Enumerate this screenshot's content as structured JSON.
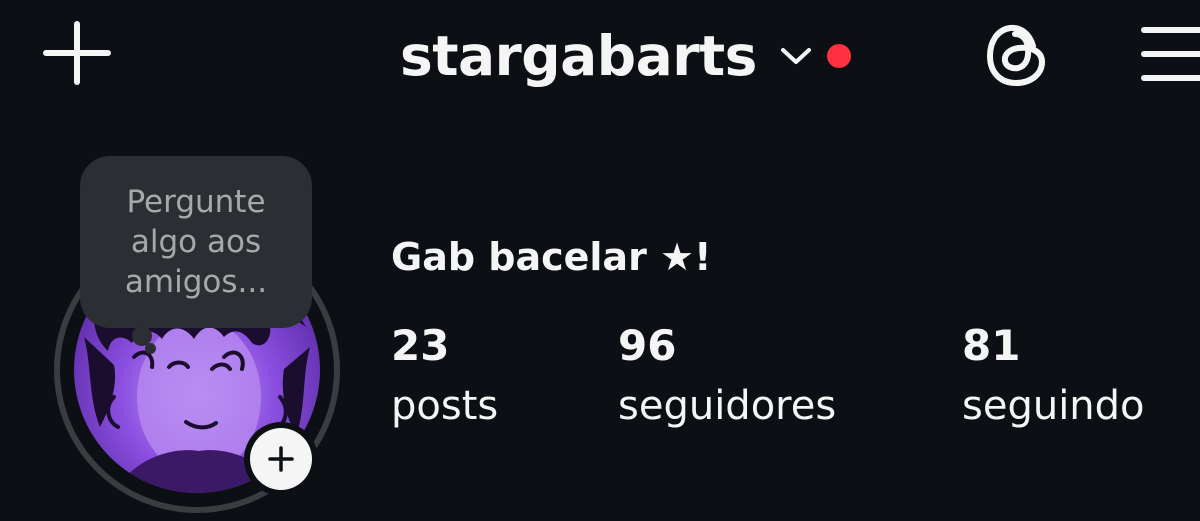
{
  "header": {
    "username": "stargabarts",
    "icons": {
      "create": "plus-icon",
      "switch_account": "chevron-down-icon",
      "threads": "threads-icon",
      "menu": "hamburger-menu-icon"
    },
    "notification_dot_color": "#ff3040"
  },
  "profile": {
    "note_prompt": "Pergunte algo aos amigos...",
    "display_name": "Gab bacelar ★!",
    "stats": [
      {
        "count": "23",
        "label": "posts"
      },
      {
        "count": "96",
        "label": "seguidores"
      },
      {
        "count": "81",
        "label": "seguindo"
      }
    ]
  },
  "theme": {
    "background": "#0c1014",
    "text": "#f5f5f5",
    "bubble": "#2b2e33",
    "muted_text": "#a8a8a8",
    "avatar_accent": "#7b3fd9"
  }
}
